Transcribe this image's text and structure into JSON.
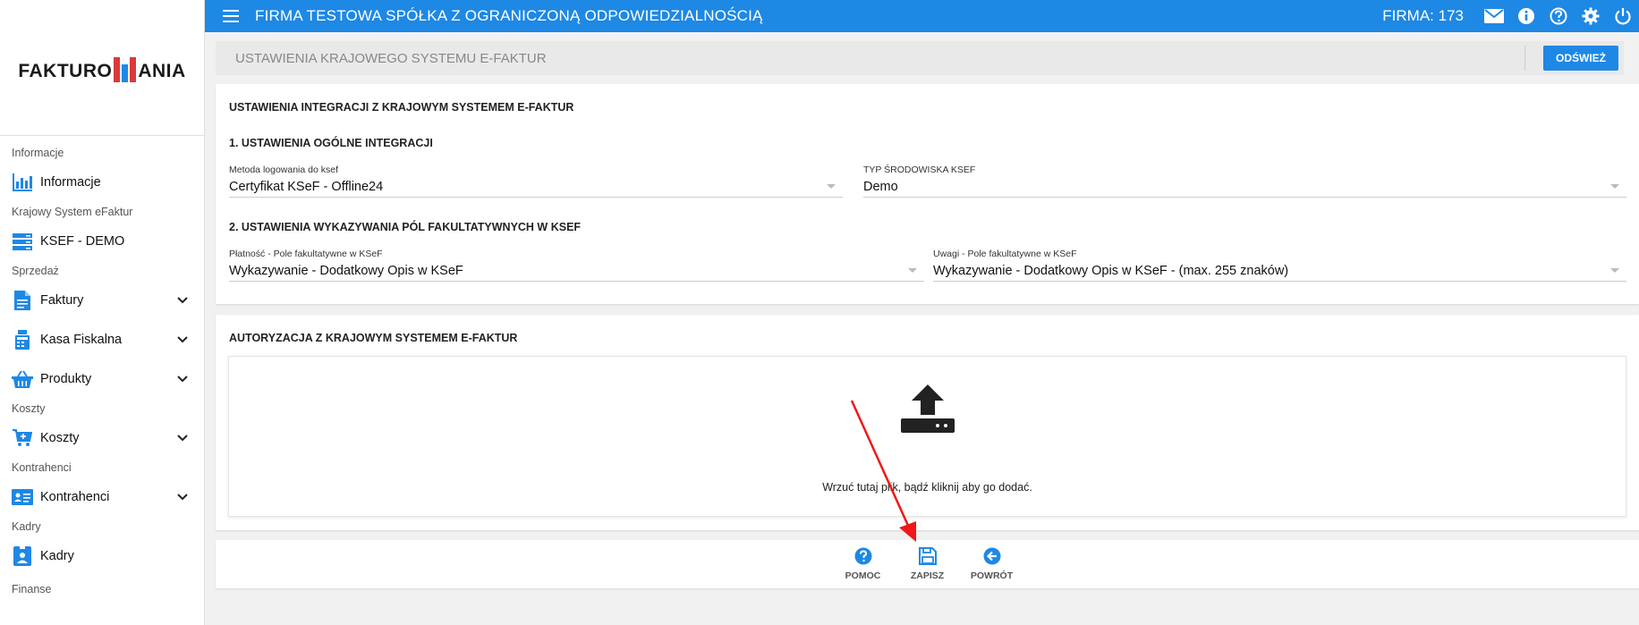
{
  "logo": {
    "text_left": "FAKTURO",
    "text_right": "ANIA"
  },
  "topbar": {
    "company_name": "FIRMA TESTOWA SPÓŁKA Z OGRANICZONĄ ODPOWIEDZIALNOŚCIĄ",
    "firma_label": "FIRMA: 173",
    "icons": [
      "envelope-icon",
      "info-icon",
      "help-icon",
      "gear-icon",
      "power-icon"
    ],
    "accent_color": "#1e88e5"
  },
  "sidebar": {
    "sections": [
      {
        "label": "Informacje",
        "items": [
          {
            "label": "Informacje",
            "icon": "bar-chart-icon",
            "expandable": false
          }
        ]
      },
      {
        "label": "Krajowy System eFaktur",
        "items": [
          {
            "label": "KSEF - DEMO",
            "icon": "server-icon",
            "expandable": false
          }
        ]
      },
      {
        "label": "Sprzedaż",
        "items": [
          {
            "label": "Faktury",
            "icon": "document-icon",
            "expandable": true
          },
          {
            "label": "Kasa Fiskalna",
            "icon": "cash-register-icon",
            "expandable": true
          },
          {
            "label": "Produkty",
            "icon": "basket-icon",
            "expandable": true
          }
        ]
      },
      {
        "label": "Koszty",
        "items": [
          {
            "label": "Koszty",
            "icon": "cart-icon",
            "expandable": true
          }
        ]
      },
      {
        "label": "Kontrahenci",
        "items": [
          {
            "label": "Kontrahenci",
            "icon": "contact-card-icon",
            "expandable": true
          }
        ]
      },
      {
        "label": "Kadry",
        "items": [
          {
            "label": "Kadry",
            "icon": "employee-icon",
            "expandable": false
          }
        ]
      },
      {
        "label": "Finanse",
        "items": []
      }
    ]
  },
  "header": {
    "title": "USTAWIENIA KRAJOWEGO SYSTEMU E-FAKTUR",
    "refresh_label": "ODŚWIEŻ"
  },
  "integration": {
    "title": "USTAWIENIA INTEGRACJI Z KRAJOWYM SYSTEMEM E-FAKTUR",
    "general_title": "1. USTAWIENIA OGÓLNE INTEGRACJI",
    "login_method_label": "Metoda logowania do ksef",
    "login_method_value": "Certyfikat KSeF - Offline24",
    "env_type_label": "TYP ŚRODOWISKA KSEF",
    "env_type_value": "Demo",
    "optional_title": "2. USTAWIENIA WYKAZYWANIA PÓL FAKULTATYWNYCH W KSEF",
    "payment_label": "Płatność - Pole fakultatywne w KSeF",
    "payment_value": "Wykazywanie - Dodatkowy Opis w KSeF",
    "notes_label": "Uwagi - Pole fakultatywne w KSeF",
    "notes_value": "Wykazywanie - Dodatkowy Opis w KSeF - (max. 255 znaków)"
  },
  "authorization": {
    "title": "AUTORYZACJA Z KRAJOWYM SYSTEMEM E-FAKTUR",
    "drop_text": "Wrzuć tutaj plik, bądź kliknij aby go dodać."
  },
  "actions": {
    "help_label": "POMOC",
    "save_label": "ZAPISZ",
    "back_label": "POWRÓT"
  }
}
